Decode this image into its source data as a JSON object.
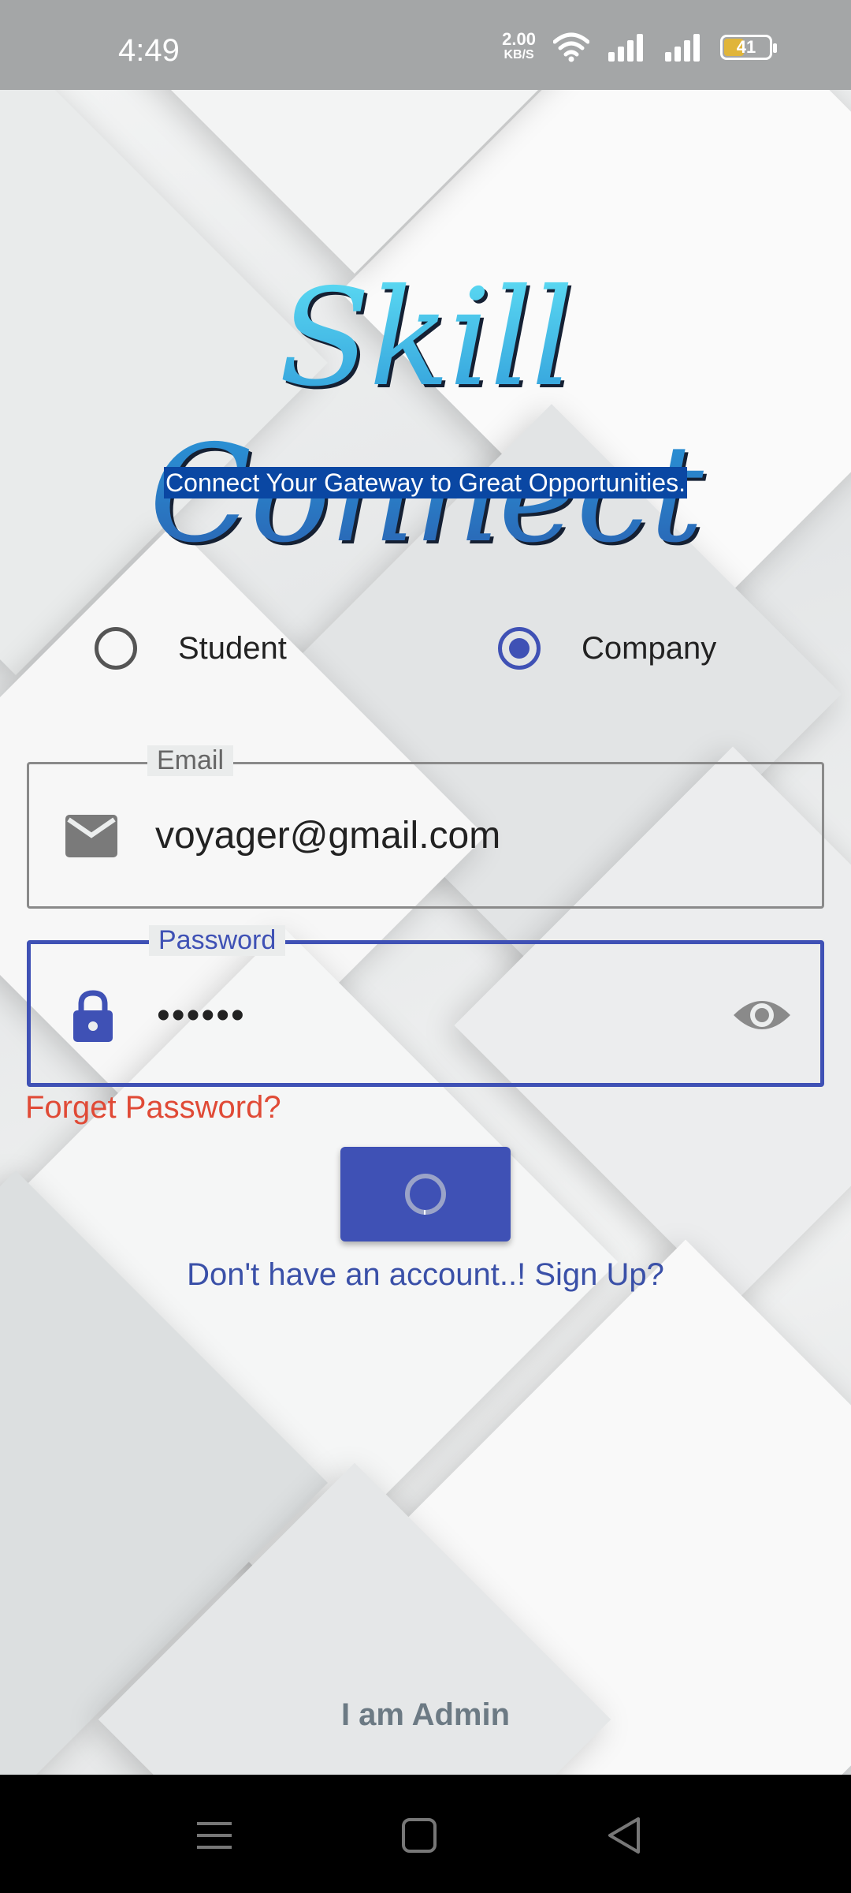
{
  "status_bar": {
    "time": "4:49",
    "net_speed_value": "2.00",
    "net_speed_unit": "KB/S",
    "battery": "41"
  },
  "app": {
    "logo_text": "Skill Connect",
    "tagline": "Connect Your Gateway to Great Opportunities."
  },
  "role_options": [
    {
      "label": "Student",
      "selected": false
    },
    {
      "label": "Company",
      "selected": true
    }
  ],
  "email_field": {
    "label": "Email",
    "value": "voyager@gmail.com"
  },
  "password_field": {
    "label": "Password",
    "value": "••••••"
  },
  "links": {
    "forgot_password": "Forget Password?",
    "sign_up": "Don't have an account..! Sign Up?",
    "admin": "I am Admin"
  },
  "colors": {
    "primary": "#3f51b5",
    "error": "#e04a36",
    "tagline_bg": "#0a47a3"
  }
}
